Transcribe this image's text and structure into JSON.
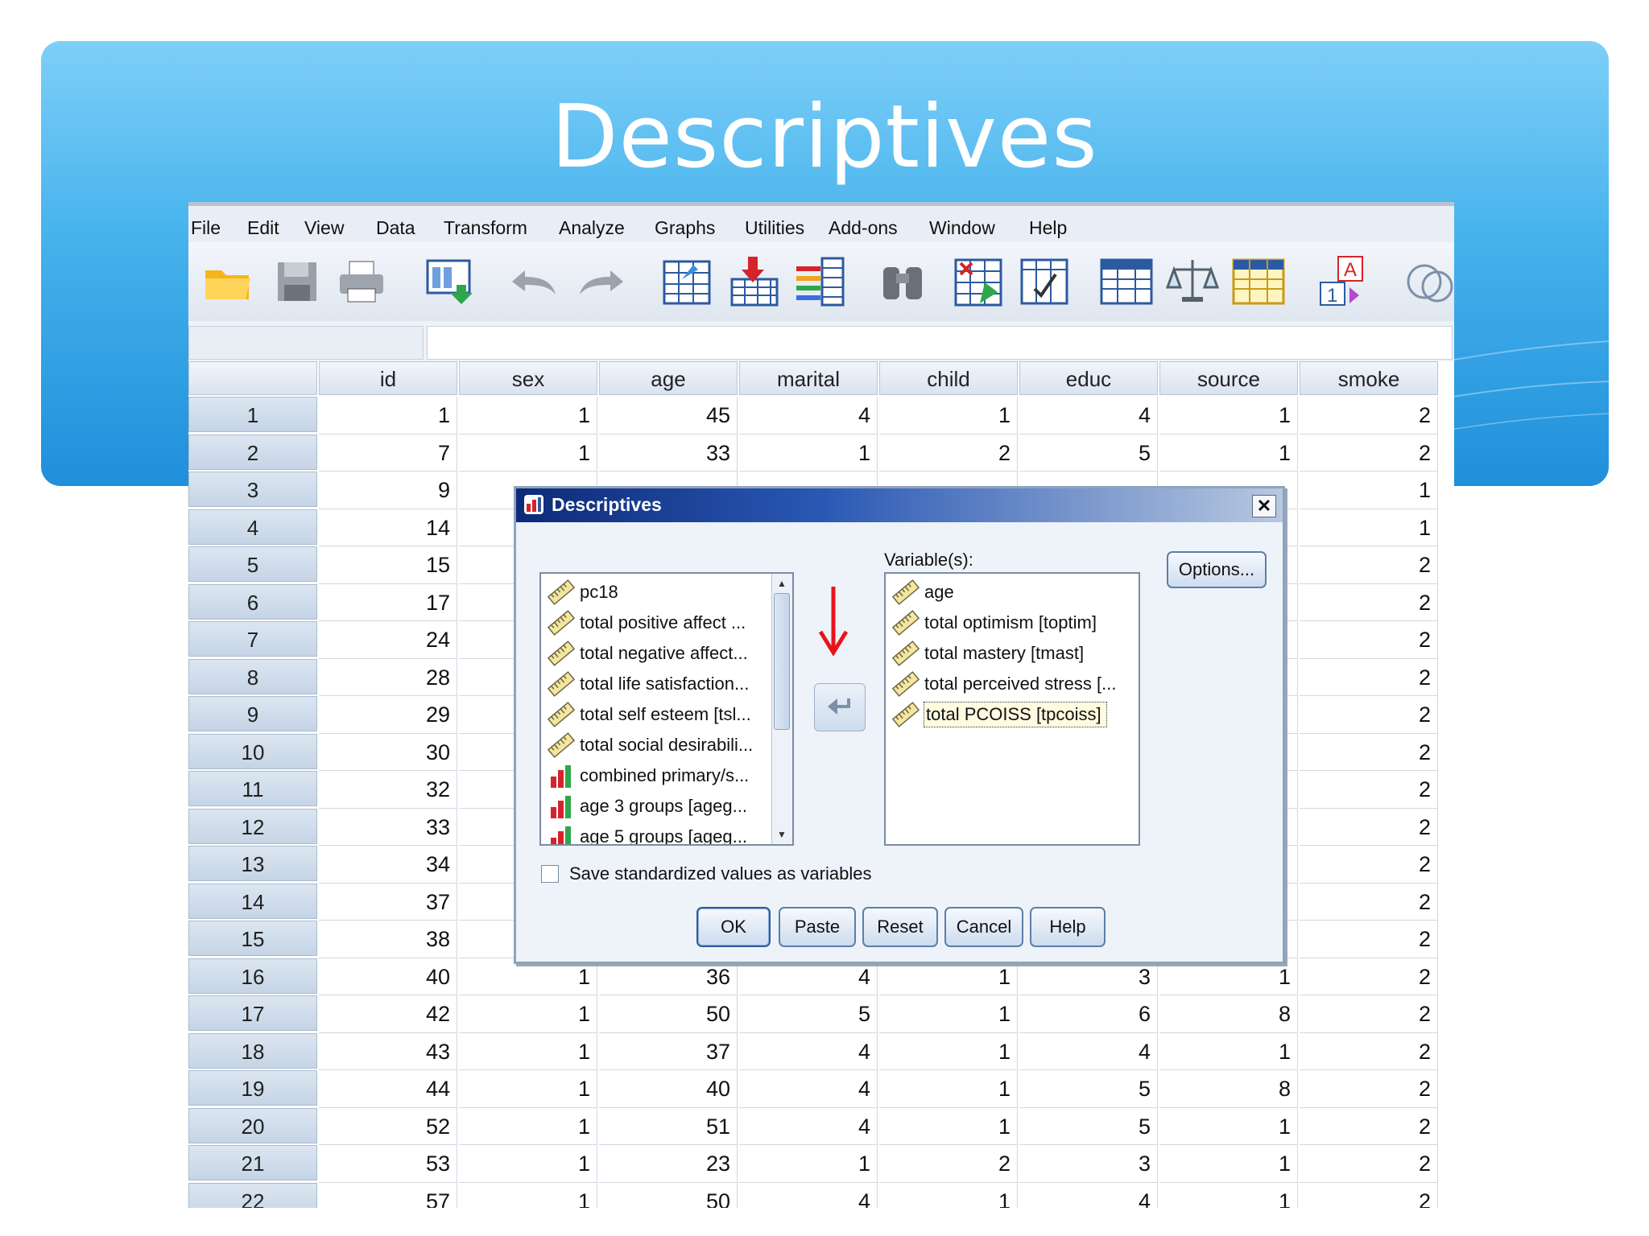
{
  "slide": {
    "title": "Descriptives"
  },
  "menu": [
    "File",
    "Edit",
    "View",
    "Data",
    "Transform",
    "Analyze",
    "Graphs",
    "Utilities",
    "Add-ons",
    "Window",
    "Help"
  ],
  "toolbar": [
    "open-folder-icon",
    "save-icon",
    "print-icon",
    "dialog-recall-icon",
    "undo-icon",
    "redo-icon",
    "goto-case-icon",
    "insert-cases-icon",
    "insert-variable-icon",
    "find-icon",
    "select-cases-icon",
    "value-labels-icon",
    "split-file-icon",
    "weight-cases-icon",
    "use-variable-sets-icon",
    "show-all-variables-icon",
    "spell-check-icon"
  ],
  "grid": {
    "columns": [
      "id",
      "sex",
      "age",
      "marital",
      "child",
      "educ",
      "source",
      "smoke"
    ],
    "rows": [
      {
        "n": "1",
        "v": [
          "1",
          "1",
          "45",
          "4",
          "1",
          "4",
          "1",
          "2"
        ]
      },
      {
        "n": "2",
        "v": [
          "7",
          "1",
          "33",
          "1",
          "2",
          "5",
          "1",
          "2"
        ]
      },
      {
        "n": "3",
        "v": [
          "9",
          "",
          "",
          "",
          "",
          "",
          "",
          "1"
        ]
      },
      {
        "n": "4",
        "v": [
          "14",
          "",
          "",
          "",
          "",
          "",
          "",
          "1"
        ]
      },
      {
        "n": "5",
        "v": [
          "15",
          "",
          "",
          "",
          "",
          "",
          "",
          "2"
        ]
      },
      {
        "n": "6",
        "v": [
          "17",
          "",
          "",
          "",
          "",
          "",
          "",
          "2"
        ]
      },
      {
        "n": "7",
        "v": [
          "24",
          "",
          "",
          "",
          "",
          "",
          "",
          "2"
        ]
      },
      {
        "n": "8",
        "v": [
          "28",
          "",
          "",
          "",
          "",
          "",
          "",
          "2"
        ]
      },
      {
        "n": "9",
        "v": [
          "29",
          "",
          "",
          "",
          "",
          "",
          "",
          "2"
        ]
      },
      {
        "n": "10",
        "v": [
          "30",
          "",
          "",
          "",
          "",
          "",
          "",
          "2"
        ]
      },
      {
        "n": "11",
        "v": [
          "32",
          "",
          "",
          "",
          "",
          "",
          "",
          "2"
        ]
      },
      {
        "n": "12",
        "v": [
          "33",
          "",
          "",
          "",
          "",
          "",
          "",
          "2"
        ]
      },
      {
        "n": "13",
        "v": [
          "34",
          "",
          "",
          "",
          "",
          "",
          "",
          "2"
        ]
      },
      {
        "n": "14",
        "v": [
          "37",
          "",
          "",
          "",
          "",
          "",
          "",
          "2"
        ]
      },
      {
        "n": "15",
        "v": [
          "38",
          "",
          "",
          "",
          "",
          "",
          "",
          "2"
        ]
      },
      {
        "n": "16",
        "v": [
          "40",
          "1",
          "36",
          "4",
          "1",
          "3",
          "1",
          "2"
        ]
      },
      {
        "n": "17",
        "v": [
          "42",
          "1",
          "50",
          "5",
          "1",
          "6",
          "8",
          "2"
        ]
      },
      {
        "n": "18",
        "v": [
          "43",
          "1",
          "37",
          "4",
          "1",
          "4",
          "1",
          "2"
        ]
      },
      {
        "n": "19",
        "v": [
          "44",
          "1",
          "40",
          "4",
          "1",
          "5",
          "8",
          "2"
        ]
      },
      {
        "n": "20",
        "v": [
          "52",
          "1",
          "51",
          "4",
          "1",
          "5",
          "1",
          "2"
        ]
      },
      {
        "n": "21",
        "v": [
          "53",
          "1",
          "23",
          "1",
          "2",
          "3",
          "1",
          "2"
        ]
      },
      {
        "n": "22",
        "v": [
          "57",
          "1",
          "50",
          "4",
          "1",
          "4",
          "1",
          "2"
        ]
      }
    ]
  },
  "dialog": {
    "title": "Descriptives",
    "close": "✕",
    "variables_label": "Variable(s):",
    "source_list": [
      {
        "label": "pc18",
        "type": "scale"
      },
      {
        "label": "total positive affect ...",
        "type": "scale"
      },
      {
        "label": "total negative affect...",
        "type": "scale"
      },
      {
        "label": "total life satisfaction...",
        "type": "scale"
      },
      {
        "label": "total self esteem [tsl...",
        "type": "scale"
      },
      {
        "label": "total social desirabili...",
        "type": "scale"
      },
      {
        "label": "combined primary/s...",
        "type": "ordinal"
      },
      {
        "label": "age 3 groups [ageg...",
        "type": "ordinal"
      },
      {
        "label": "age 5 groups [ageg...",
        "type": "ordinal"
      }
    ],
    "target_list": [
      {
        "label": "age",
        "type": "scale"
      },
      {
        "label": "total optimism [toptim]",
        "type": "scale"
      },
      {
        "label": "total mastery [tmast]",
        "type": "scale"
      },
      {
        "label": "total perceived stress [...",
        "type": "scale"
      },
      {
        "label": "total PCOISS [tpcoiss]",
        "type": "scale",
        "selected": true
      }
    ],
    "options_button": "Options...",
    "save_checkbox_label": "Save standardized values as variables",
    "save_checked": false,
    "buttons": [
      "OK",
      "Paste",
      "Reset",
      "Cancel",
      "Help"
    ]
  },
  "colors": {
    "annotation_arrow": "#e8141c",
    "title_bar": "#0d2a78",
    "banner": "#45b2ec"
  }
}
